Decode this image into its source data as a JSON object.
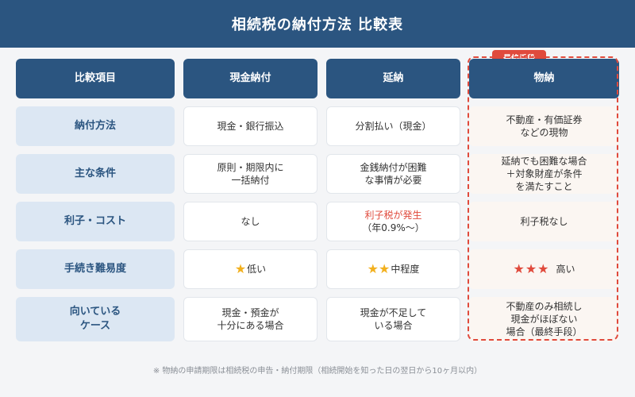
{
  "title": "相続税の納付方法 比較表",
  "badge": "最終手段",
  "headers": [
    "比較項目",
    "現金納付",
    "延納",
    "物納"
  ],
  "rows": [
    {
      "label": [
        "納付方法"
      ],
      "cash": [
        "現金・銀行振込"
      ],
      "deferred": [
        "分割払い（現金）"
      ],
      "inkind": [
        "不動産・有価証券",
        "などの現物"
      ]
    },
    {
      "label": [
        "主な条件"
      ],
      "cash": [
        "原則・期限内に",
        "一括納付"
      ],
      "deferred": [
        "金銭納付が困難",
        "な事情が必要"
      ],
      "inkind": [
        "延納でも困難な場合",
        "＋対象財産が条件",
        "を満たすこと"
      ]
    },
    {
      "label": [
        "利子・コスト"
      ],
      "cash": [
        "なし"
      ],
      "deferred": [
        "利子税が発生",
        "（年0.9%〜）"
      ],
      "inkind": [
        "利子税なし"
      ]
    },
    {
      "label": [
        "手続き難易度"
      ],
      "cash": {
        "stars": "★",
        "text": "低い"
      },
      "deferred": {
        "stars": "★★",
        "text": "中程度"
      },
      "inkind": {
        "stars": "★★★",
        "text": "高い"
      }
    },
    {
      "label": [
        "向いている",
        "ケース"
      ],
      "cash": [
        "現金・預金が",
        "十分にある場合"
      ],
      "deferred": [
        "現金が不足して",
        "いる場合"
      ],
      "inkind": [
        "不動産のみ相続し",
        "現金がほぼない",
        "場合（最終手段）"
      ]
    }
  ],
  "footnote": "※ 物納の申請期限は相続税の申告・納付期限（相続開始を知った日の翌日から10ヶ月以内）",
  "colors": {
    "navy": "#2b5580",
    "label_bg": "#dce7f3",
    "accent_red": "#e04a3c",
    "star_gold": "#f2b01e"
  }
}
